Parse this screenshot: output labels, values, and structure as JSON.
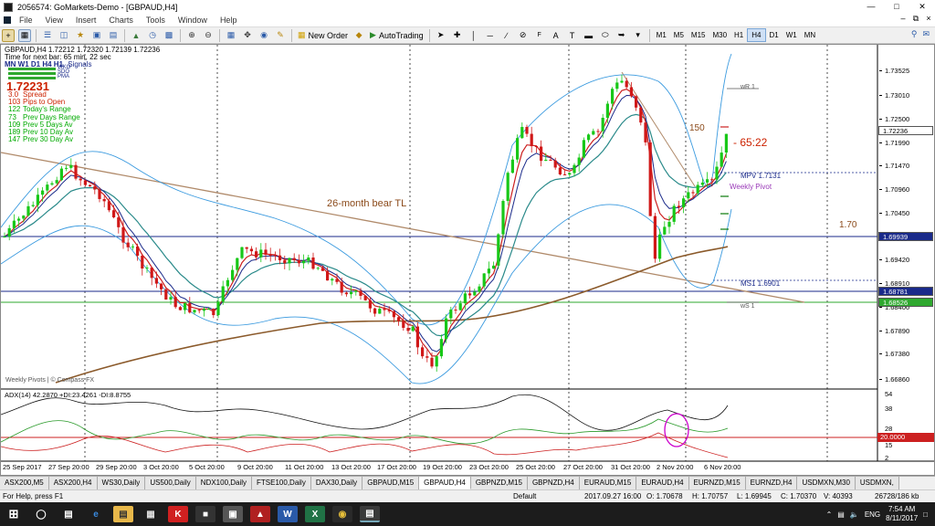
{
  "window": {
    "title": "2056574: GoMarkets-Demo - [GBPAUD,H4]"
  },
  "menu": [
    "File",
    "View",
    "Insert",
    "Charts",
    "Tools",
    "Window",
    "Help"
  ],
  "toolbar": {
    "new_order": "New Order",
    "autotrading": "AutoTrading",
    "timeframes": [
      "M1",
      "M5",
      "M15",
      "M30",
      "H1",
      "H4",
      "D1",
      "W1",
      "MN"
    ],
    "active_tf": "H4"
  },
  "chart": {
    "header": "GBPAUD,H4  1.72212 1.72320 1.72139 1.72236",
    "timer": "Time for next bar: 65 min, 22 sec",
    "tf_row": "MN W1 D1 H4 H1",
    "tf_signals": "Signals",
    "legend_small": [
      "WKO",
      "SDO",
      "PMA"
    ],
    "price_big": "1.72231",
    "info_rows": [
      {
        "num": "3.0",
        "label": "Spread",
        "color": "#cc2200"
      },
      {
        "num": "103",
        "label": "Pips to Open",
        "color": "#cc2200"
      },
      {
        "num": "122",
        "label": "Today's Range",
        "color": "#00aa00"
      },
      {
        "num": "73",
        "label": "Prev Days Range",
        "color": "#00aa00"
      },
      {
        "num": "109",
        "label": "Prev 5 Days Av",
        "color": "#00aa00"
      },
      {
        "num": "189",
        "label": "Prev 10 Day Av",
        "color": "#00aa00"
      },
      {
        "num": "147",
        "label": "Prev 30 Day Av",
        "color": "#00aa00"
      }
    ],
    "annotations": {
      "bear_tl": "26-month bear TL",
      "num150": "150",
      "countdown": "- 65:22",
      "level170": "1.70",
      "wr1": "wR 1",
      "mpv": "MPV  1.7131",
      "weekly_pivot": "Weekly Pivot",
      "ms1": "MS1  1.6901",
      "ws1": "wS 1",
      "footer": "Weekly Pivots | © Compass FX"
    },
    "price_axis": [
      "1.73525",
      "1.73010",
      "1.72500",
      "1.71990",
      "1.71470",
      "1.70960",
      "1.70450",
      "1.69420",
      "1.68910",
      "1.68400",
      "1.67890",
      "1.67380",
      "1.66860"
    ],
    "price_tags": [
      {
        "value": "1.72236",
        "bg": "#ffffff",
        "fg": "#000000"
      },
      {
        "value": "1.69939",
        "bg": "#1a2a8a",
        "fg": "#ffffff"
      },
      {
        "value": "1.68781",
        "bg": "#1a2a8a",
        "fg": "#ffffff"
      },
      {
        "value": "1.68526",
        "bg": "#2ea82e",
        "fg": "#ffffff"
      }
    ],
    "time_axis": [
      "25 Sep 2017",
      "27 Sep 20:00",
      "29 Sep 20:00",
      "3 Oct 20:00",
      "5 Oct 20:00",
      "9 Oct 20:00",
      "11 Oct 20:00",
      "13 Oct 20:00",
      "17 Oct 20:00",
      "19 Oct 20:00",
      "23 Oct 20:00",
      "25 Oct 20:00",
      "27 Oct 20:00",
      "31 Oct 20:00",
      "2 Nov 20:00",
      "6 Nov 20:00"
    ],
    "adx_header": "ADX(14) 42.2870 +DI:23.4261 -DI:8.8755",
    "adx_axis": [
      "54",
      "38",
      "28",
      "15",
      "2"
    ],
    "adx_tag": "20.0000"
  },
  "tabs": [
    "ASX200,M5",
    "ASX200,H4",
    "WS30,Daily",
    "US500,Daily",
    "NDX100,Daily",
    "FTSE100,Daily",
    "DAX30,Daily",
    "GBPAUD,M15",
    "GBPAUD,H4",
    "GBPNZD,M15",
    "GBPNZD,H4",
    "EURAUD,M15",
    "EURAUD,H4",
    "EURNZD,M15",
    "EURNZD,H4",
    "USDMXN,M30",
    "USDMXN,"
  ],
  "active_tab": "GBPAUD,H4",
  "status": {
    "help": "For Help, press F1",
    "profile": "Default",
    "date": "2017.09.27 16:00",
    "open": "O: 1.70678",
    "high": "H: 1.70757",
    "low": "L: 1.69945",
    "close": "C: 1.70370",
    "volume": "V: 40393",
    "traffic": "26728/186 kb"
  },
  "taskbar": {
    "lang": "ENG",
    "time": "7:54 AM",
    "date": "8/11/2017"
  }
}
